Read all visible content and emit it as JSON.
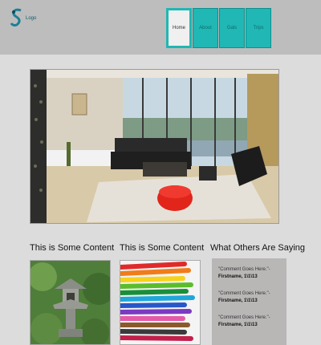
{
  "brand": {
    "name": "Logo"
  },
  "nav": {
    "items": [
      {
        "label": "Home",
        "active": true
      },
      {
        "label": "About",
        "active": false
      },
      {
        "label": "Gals",
        "active": false
      },
      {
        "label": "Trips",
        "active": false
      }
    ]
  },
  "sections": {
    "content1": {
      "title": "This is Some Content"
    },
    "content2": {
      "title": "This is Some Content"
    },
    "testimonials": {
      "title": "What Others Are Saying",
      "quotes": [
        {
          "text": "\"Comment Goes Here.\"-",
          "author": "Firstname, 1\\1\\13"
        },
        {
          "text": "\"Comment Goes Here.\"-",
          "author": "Firstname, 1\\1\\13"
        },
        {
          "text": "\"Comment Goes Here.\"-",
          "author": "Firstname, 1\\1\\13"
        }
      ]
    }
  },
  "colors": {
    "accent": "#20b7b4",
    "header_bg": "#bdbdbd",
    "page_bg": "#dcdcdc",
    "panel_bg": "#b9b6b6"
  }
}
